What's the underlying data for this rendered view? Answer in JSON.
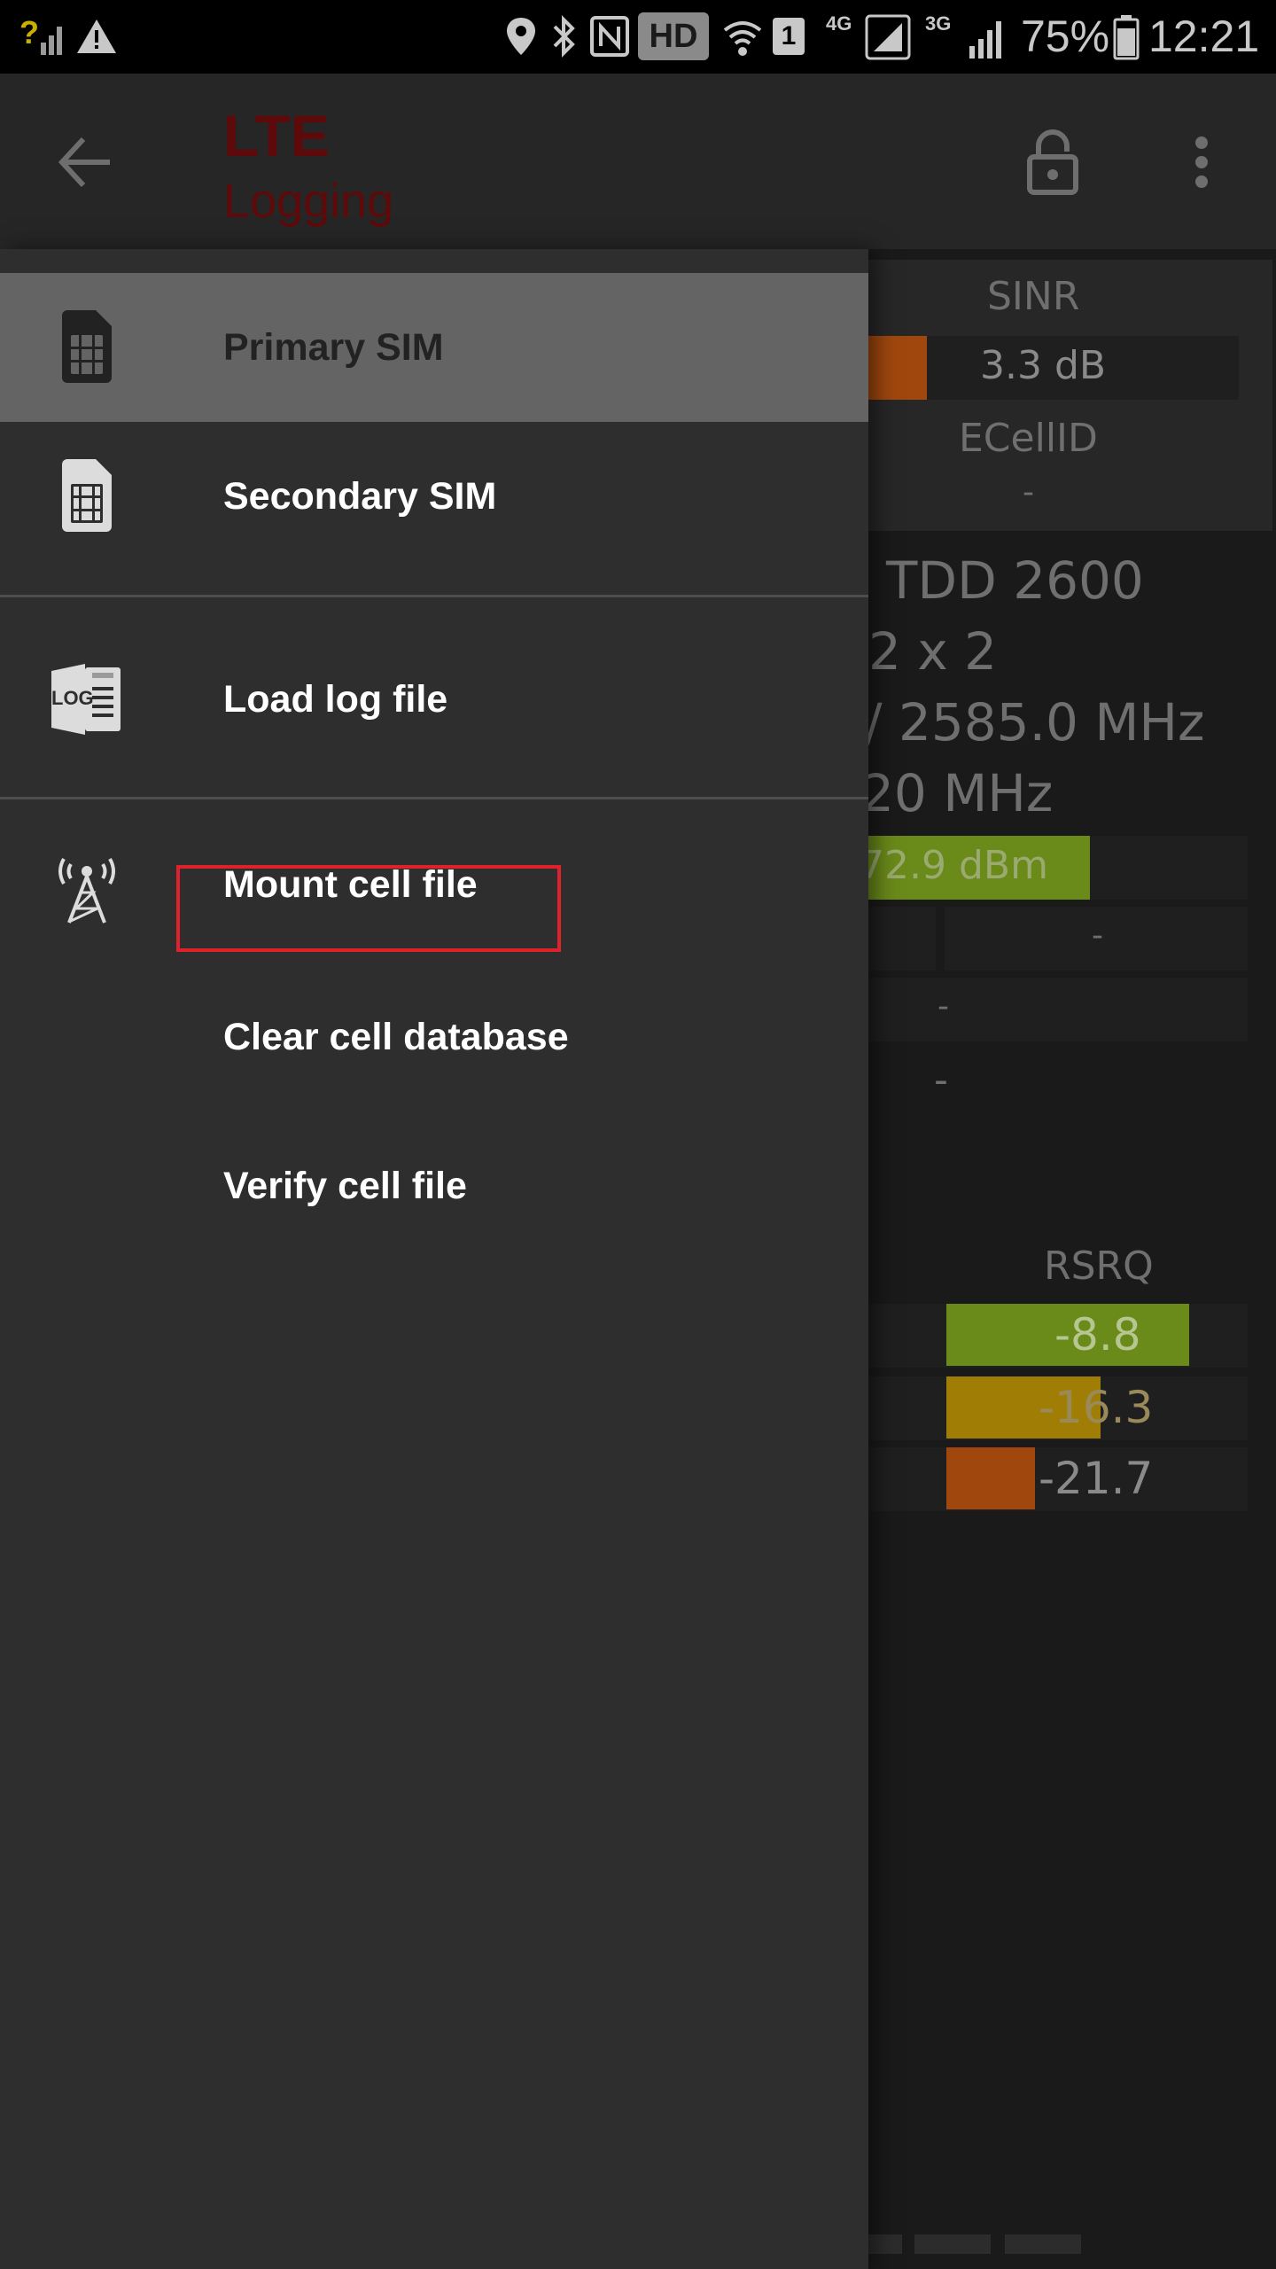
{
  "status_bar": {
    "signal_unknown_label": "?",
    "battery_percent": "75%",
    "time": "12:21",
    "hd_badge": "HD",
    "sim_badge": "1",
    "net_4g": "4G",
    "net_3g": "3G",
    "icons": [
      "signal-unknown-icon",
      "warning-icon",
      "location-icon",
      "bluetooth-icon",
      "nfc-icon",
      "hd-voice-icon",
      "wifi-calling-icon",
      "sim1-icon",
      "signal-4g-icon",
      "signal-3g-icon",
      "battery-icon"
    ]
  },
  "toolbar": {
    "title": "LTE",
    "subtitle": "Logging",
    "icons": [
      "back-arrow-icon",
      "lock-icon",
      "more-vert-icon"
    ]
  },
  "background": {
    "sinr_label": "SINR",
    "sinr_value": "3.3 dB",
    "ecellid_label": "ECellID",
    "ecellid_value": "-",
    "band_text": "TDD 2600",
    "mimo_text": "2 x 2",
    "freq_text": "/ 2585.0 MHz",
    "bandwidth_text": "20 MHz",
    "rsrp_value": "72.9 dBm",
    "dash_1": "-",
    "dash_2": "-",
    "dash_3": "-",
    "rsrq_label": "RSRQ",
    "rsrq_values": [
      "-8.8",
      "-16.3",
      "-21.7"
    ],
    "colors": {
      "green": "#6a8a1a",
      "yellow": "#a07e06",
      "orange": "#a0470e"
    }
  },
  "drawer": {
    "items": [
      {
        "label": "Primary SIM",
        "icon": "sim-card-icon",
        "selected": true
      },
      {
        "label": "Secondary SIM",
        "icon": "sim-card-icon",
        "selected": false
      },
      {
        "label": "Load log file",
        "icon": "log-file-icon",
        "selected": false
      },
      {
        "label": "Mount cell file",
        "icon": "cell-tower-icon",
        "selected": false
      },
      {
        "label": "Clear cell database",
        "icon": "",
        "selected": false
      },
      {
        "label": "Verify cell file",
        "icon": "",
        "selected": false
      }
    ],
    "log_icon_text": "LOG",
    "highlight_color": "#e0202a"
  }
}
